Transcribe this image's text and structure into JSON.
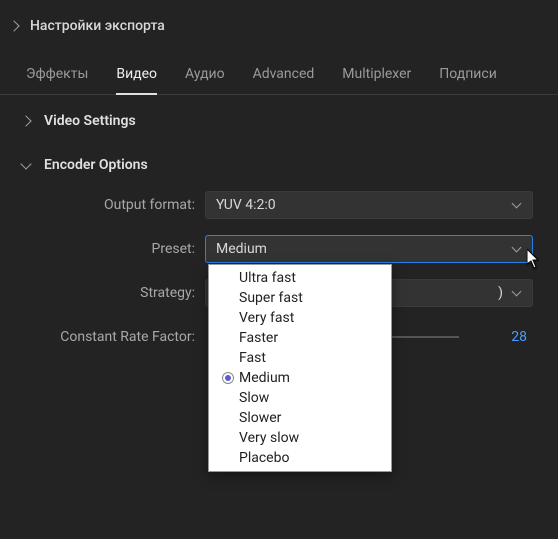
{
  "export_section": {
    "title": "Настройки экспорта"
  },
  "tabs": {
    "items": [
      {
        "label": "Эффекты"
      },
      {
        "label": "Видео"
      },
      {
        "label": "Аудио"
      },
      {
        "label": "Advanced"
      },
      {
        "label": "Multiplexer"
      },
      {
        "label": "Подписи"
      }
    ],
    "active_index": 1
  },
  "subsections": {
    "video_settings": {
      "title": "Video Settings"
    },
    "encoder_options": {
      "title": "Encoder Options"
    }
  },
  "form": {
    "output_format": {
      "label": "Output format:",
      "value": "YUV 4:2:0"
    },
    "preset": {
      "label": "Preset:",
      "value": "Medium",
      "options": [
        "Ultra fast",
        "Super fast",
        "Very fast",
        "Faster",
        "Fast",
        "Medium",
        "Slow",
        "Slower",
        "Very slow",
        "Placebo"
      ],
      "selected_index": 5
    },
    "strategy": {
      "label": "Strategy:",
      "value_suffix": ")"
    },
    "crf": {
      "label": "Constant Rate Factor:",
      "value": "28"
    }
  }
}
